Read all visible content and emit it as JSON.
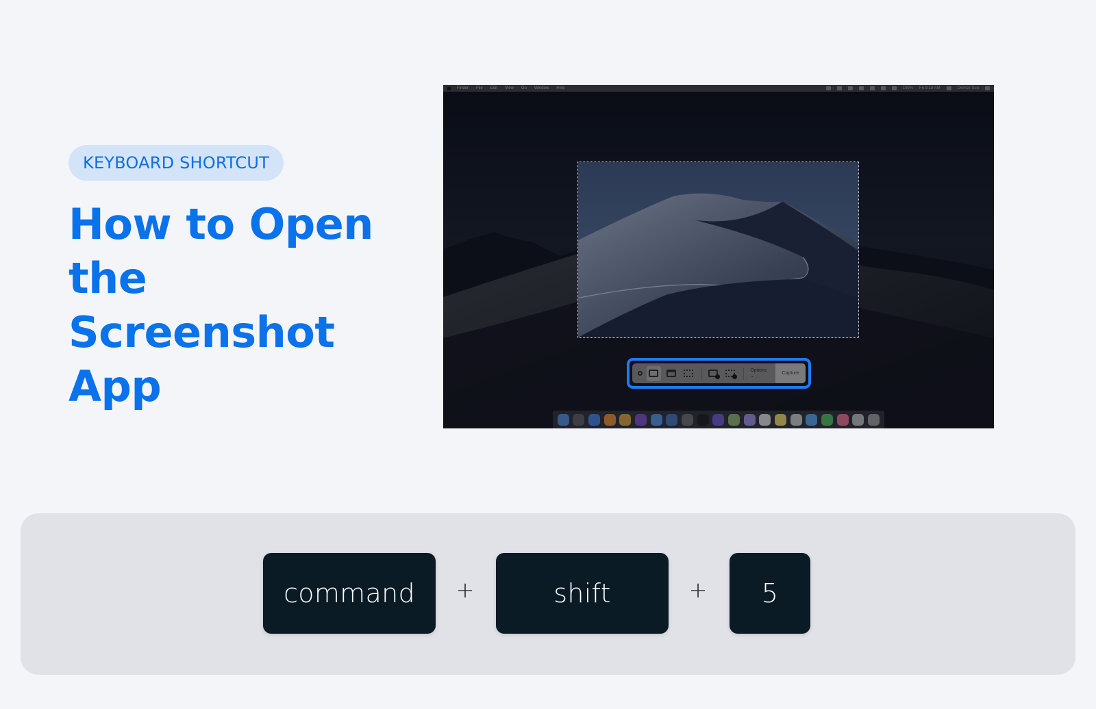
{
  "badge": {
    "label": "KEYBOARD SHORTCUT"
  },
  "title": {
    "lines": [
      "How to Open",
      "the Screenshot",
      "App"
    ]
  },
  "colors": {
    "accent": "#0a72ea",
    "badge_bg": "#d3e4f8",
    "key_bg": "#0b1b26",
    "panel_bg": "#e0e2e7",
    "page_bg": "#f4f5f8",
    "highlight": "#1e7bf2"
  },
  "mac_screenshot": {
    "menubar": {
      "apple_icon": "apple-logo-icon",
      "menus": [
        "Finder",
        "File",
        "Edit",
        "View",
        "Go",
        "Window",
        "Help"
      ],
      "status": {
        "battery": "100%",
        "clock": "Fri 8:19 AM",
        "user": "Derrick Sun"
      },
      "tray_icons": [
        "dropbox-icon",
        "screen-icon",
        "cast-icon",
        "creative-cloud-icon",
        "time-machine-icon",
        "bluetooth-icon",
        "wifi-icon",
        "volume-icon",
        "battery-icon",
        "search-icon",
        "siri-icon",
        "list-icon"
      ]
    },
    "screenshot_toolbar": {
      "buttons": [
        {
          "name": "close",
          "icon": "close-icon"
        },
        {
          "name": "capture-entire-screen",
          "icon": "full-screen-icon",
          "active": true
        },
        {
          "name": "capture-selected-window",
          "icon": "window-icon"
        },
        {
          "name": "capture-selected-portion",
          "icon": "selection-icon"
        },
        {
          "name": "record-entire-screen",
          "icon": "record-screen-icon"
        },
        {
          "name": "record-selected-portion",
          "icon": "record-selection-icon"
        }
      ],
      "options_label": "Options ⌄",
      "capture_label": "Capture"
    },
    "dock_apps": [
      "finder",
      "siri",
      "app-store",
      "books",
      "chrome",
      "imovie",
      "keynote",
      "preview",
      "launchpad",
      "apple-tv",
      "itunes",
      "maps",
      "music",
      "slack",
      "notes",
      "reminders",
      "messages",
      "facetime",
      "photos",
      "documents",
      "trash"
    ]
  },
  "shortcut": {
    "keys": [
      "command",
      "shift",
      "5"
    ],
    "separator": "+"
  }
}
